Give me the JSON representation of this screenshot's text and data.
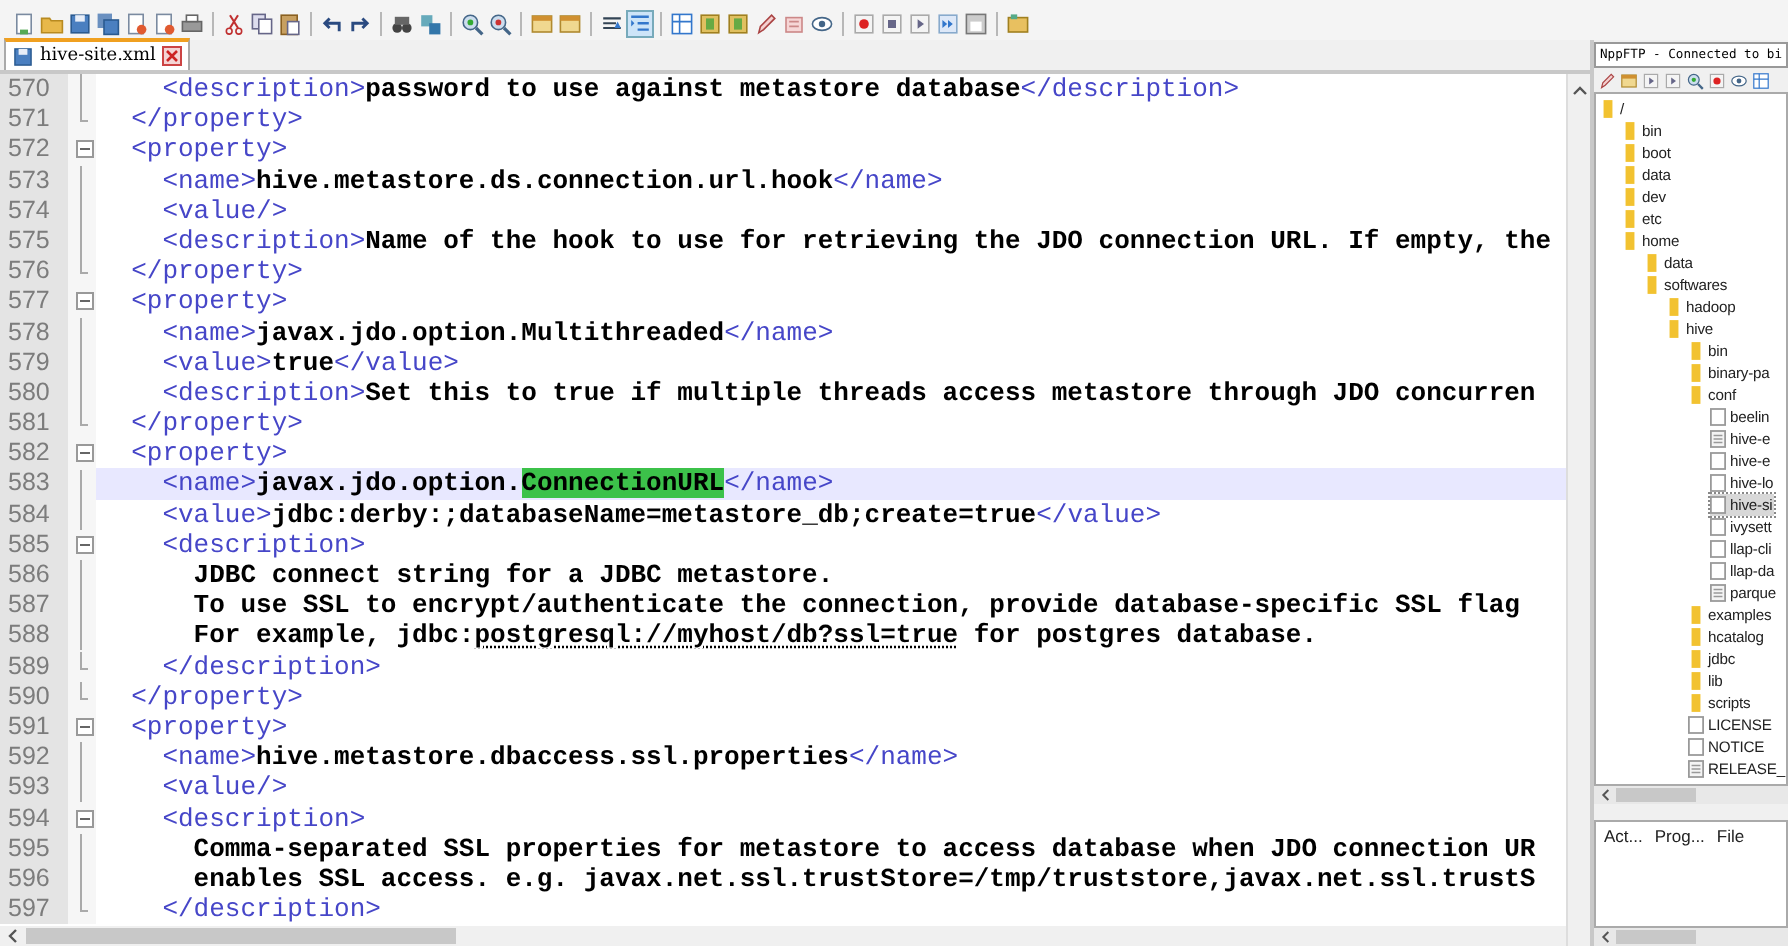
{
  "tab": {
    "title": "hive-site.xml",
    "selected": true
  },
  "editor": {
    "lines": [
      {
        "number": "570",
        "kind": "fold-middle",
        "current": false,
        "tokens": [
          {
            "kind": "tag",
            "text": "    <description>"
          },
          {
            "kind": "text",
            "text": "password to use against metastore database"
          },
          {
            "kind": "tag",
            "text": "</description>"
          }
        ]
      },
      {
        "number": "571",
        "kind": "fold-end",
        "current": false,
        "tokens": [
          {
            "kind": "tag",
            "text": "  </property>"
          }
        ]
      },
      {
        "number": "572",
        "kind": "fold-start",
        "current": false,
        "tokens": [
          {
            "kind": "tag",
            "text": "  <property>"
          }
        ]
      },
      {
        "number": "573",
        "kind": "fold-middle",
        "current": false,
        "tokens": [
          {
            "kind": "tag",
            "text": "    <name>"
          },
          {
            "kind": "text",
            "text": "hive.metastore.ds.connection.url.hook"
          },
          {
            "kind": "tag",
            "text": "</name>"
          }
        ]
      },
      {
        "number": "574",
        "kind": "fold-middle",
        "current": false,
        "tokens": [
          {
            "kind": "tag",
            "text": "    <value/>"
          }
        ]
      },
      {
        "number": "575",
        "kind": "fold-middle",
        "current": false,
        "tokens": [
          {
            "kind": "tag",
            "text": "    <description>"
          },
          {
            "kind": "text",
            "text": "Name of the hook to use for retrieving the JDO connection URL. If empty, the"
          }
        ]
      },
      {
        "number": "576",
        "kind": "fold-end",
        "current": false,
        "tokens": [
          {
            "kind": "tag",
            "text": "  </property>"
          }
        ]
      },
      {
        "number": "577",
        "kind": "fold-start",
        "current": false,
        "tokens": [
          {
            "kind": "tag",
            "text": "  <property>"
          }
        ]
      },
      {
        "number": "578",
        "kind": "fold-middle",
        "current": false,
        "tokens": [
          {
            "kind": "tag",
            "text": "    <name>"
          },
          {
            "kind": "text",
            "text": "javax.jdo.option.Multithreaded"
          },
          {
            "kind": "tag",
            "text": "</name>"
          }
        ]
      },
      {
        "number": "579",
        "kind": "fold-middle",
        "current": false,
        "tokens": [
          {
            "kind": "tag",
            "text": "    <value>"
          },
          {
            "kind": "text",
            "text": "true"
          },
          {
            "kind": "tag",
            "text": "</value>"
          }
        ]
      },
      {
        "number": "580",
        "kind": "fold-middle",
        "current": false,
        "tokens": [
          {
            "kind": "tag",
            "text": "    <description>"
          },
          {
            "kind": "text",
            "text": "Set this to true if multiple threads access metastore through JDO concurren"
          }
        ]
      },
      {
        "number": "581",
        "kind": "fold-end",
        "current": false,
        "tokens": [
          {
            "kind": "tag",
            "text": "  </property>"
          }
        ]
      },
      {
        "number": "582",
        "kind": "fold-start",
        "current": false,
        "tokens": [
          {
            "kind": "tag",
            "text": "  <property>"
          }
        ]
      },
      {
        "number": "583",
        "kind": "fold-middle",
        "current": true,
        "tokens": [
          {
            "kind": "tag",
            "text": "    <name>"
          },
          {
            "kind": "text",
            "text": "javax.jdo.option."
          },
          {
            "kind": "match",
            "text": "ConnectionURL"
          },
          {
            "kind": "tag",
            "text": "</name>"
          }
        ]
      },
      {
        "number": "584",
        "kind": "fold-middle",
        "current": false,
        "tokens": [
          {
            "kind": "tag",
            "text": "    <value>"
          },
          {
            "kind": "text",
            "text": "jdbc:derby:;databaseName=metastore_db;create=true"
          },
          {
            "kind": "tag",
            "text": "</value>"
          }
        ]
      },
      {
        "number": "585",
        "kind": "fold-start",
        "current": false,
        "tokens": [
          {
            "kind": "tag",
            "text": "    <description>"
          }
        ]
      },
      {
        "number": "586",
        "kind": "fold-middle",
        "current": false,
        "tokens": [
          {
            "kind": "text",
            "text": "      JDBC connect string for a JDBC metastore."
          }
        ]
      },
      {
        "number": "587",
        "kind": "fold-middle",
        "current": false,
        "tokens": [
          {
            "kind": "text",
            "text": "      To use SSL to encrypt/authenticate the connection, provide database-specific SSL flag"
          }
        ]
      },
      {
        "number": "588",
        "kind": "fold-middle",
        "current": false,
        "tokens": [
          {
            "kind": "text",
            "text": "      For example, jdbc:"
          },
          {
            "kind": "link",
            "text": "postgresql://myhost/db?ssl=true"
          },
          {
            "kind": "text",
            "text": " for postgres database."
          }
        ]
      },
      {
        "number": "589",
        "kind": "fold-end",
        "current": false,
        "tokens": [
          {
            "kind": "tag",
            "text": "    </description>"
          }
        ]
      },
      {
        "number": "590",
        "kind": "fold-end",
        "current": false,
        "tokens": [
          {
            "kind": "tag",
            "text": "  </property>"
          }
        ]
      },
      {
        "number": "591",
        "kind": "fold-start",
        "current": false,
        "tokens": [
          {
            "kind": "tag",
            "text": "  <property>"
          }
        ]
      },
      {
        "number": "592",
        "kind": "fold-middle",
        "current": false,
        "tokens": [
          {
            "kind": "tag",
            "text": "    <name>"
          },
          {
            "kind": "text",
            "text": "hive.metastore.dbaccess.ssl.properties"
          },
          {
            "kind": "tag",
            "text": "</name>"
          }
        ]
      },
      {
        "number": "593",
        "kind": "fold-middle",
        "current": false,
        "tokens": [
          {
            "kind": "tag",
            "text": "    <value/>"
          }
        ]
      },
      {
        "number": "594",
        "kind": "fold-start",
        "current": false,
        "tokens": [
          {
            "kind": "tag",
            "text": "    <description>"
          }
        ]
      },
      {
        "number": "595",
        "kind": "fold-middle",
        "current": false,
        "tokens": [
          {
            "kind": "text",
            "text": "      Comma-separated SSL properties for metastore to access database when JDO connection UR"
          }
        ]
      },
      {
        "number": "596",
        "kind": "fold-middle",
        "current": false,
        "tokens": [
          {
            "kind": "text",
            "text": "      enables SSL access. e.g. javax.net.ssl.trustStore=/tmp/truststore,javax.net.ssl.trustS"
          }
        ]
      },
      {
        "number": "597",
        "kind": "fold-end",
        "current": false,
        "tokens": [
          {
            "kind": "tag",
            "text": "    </description>"
          }
        ]
      }
    ]
  },
  "ftp_panel": {
    "title": "NppFTP - Connected to bi",
    "tree": [
      {
        "label": "/",
        "kind": "folder",
        "selected": false,
        "children": [
          {
            "label": "bin",
            "kind": "folder",
            "selected": false
          },
          {
            "label": "boot",
            "kind": "folder",
            "selected": false
          },
          {
            "label": "data",
            "kind": "folder",
            "selected": false
          },
          {
            "label": "dev",
            "kind": "folder",
            "selected": false
          },
          {
            "label": "etc",
            "kind": "folder",
            "selected": false
          },
          {
            "label": "home",
            "kind": "folder",
            "selected": false,
            "children": [
              {
                "label": "data",
                "kind": "folder",
                "selected": false
              },
              {
                "label": "softwares",
                "kind": "folder",
                "selected": false,
                "children": [
                  {
                    "label": "hadoop",
                    "kind": "folder",
                    "selected": false
                  },
                  {
                    "label": "hive",
                    "kind": "folder",
                    "selected": false,
                    "children": [
                      {
                        "label": "bin",
                        "kind": "folder",
                        "selected": false
                      },
                      {
                        "label": "binary-pa",
                        "kind": "folder",
                        "selected": false
                      },
                      {
                        "label": "conf",
                        "kind": "folder",
                        "selected": false,
                        "children": [
                          {
                            "label": "beelin",
                            "kind": "file",
                            "selected": false
                          },
                          {
                            "label": "hive-e",
                            "kind": "text-file",
                            "selected": false
                          },
                          {
                            "label": "hive-e",
                            "kind": "file",
                            "selected": false
                          },
                          {
                            "label": "hive-lo",
                            "kind": "file",
                            "selected": false
                          },
                          {
                            "label": "hive-si",
                            "kind": "file",
                            "selected": true
                          },
                          {
                            "label": "ivysett",
                            "kind": "file",
                            "selected": false
                          },
                          {
                            "label": "llap-cli",
                            "kind": "file",
                            "selected": false
                          },
                          {
                            "label": "llap-da",
                            "kind": "file",
                            "selected": false
                          },
                          {
                            "label": "parque",
                            "kind": "text-file",
                            "selected": false
                          }
                        ]
                      },
                      {
                        "label": "examples",
                        "kind": "folder",
                        "selected": false
                      },
                      {
                        "label": "hcatalog",
                        "kind": "folder",
                        "selected": false
                      },
                      {
                        "label": "jdbc",
                        "kind": "folder",
                        "selected": false
                      },
                      {
                        "label": "lib",
                        "kind": "folder",
                        "selected": false
                      },
                      {
                        "label": "scripts",
                        "kind": "folder",
                        "selected": false
                      },
                      {
                        "label": "LICENSE",
                        "kind": "file",
                        "selected": false
                      },
                      {
                        "label": "NOTICE",
                        "kind": "file",
                        "selected": false
                      },
                      {
                        "label": "RELEASE_",
                        "kind": "text-file",
                        "selected": false
                      }
                    ]
                  }
                ]
              }
            ]
          }
        ]
      }
    ],
    "queue_columns": [
      "Act...",
      "Prog...",
      "File"
    ]
  }
}
